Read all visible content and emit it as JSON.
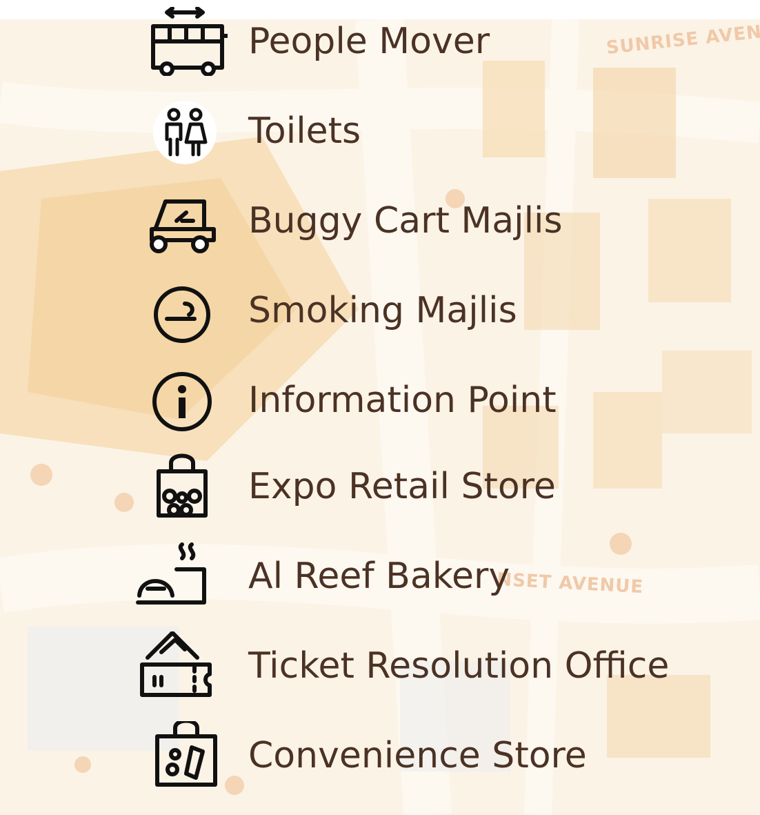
{
  "map": {
    "streets": [
      {
        "label": "SUNRISE AVENU"
      },
      {
        "label": "NSET AVENUE"
      }
    ]
  },
  "legend": {
    "items": [
      {
        "label": "People Mover",
        "icon": "people-mover-icon"
      },
      {
        "label": "Toilets",
        "icon": "toilets-icon"
      },
      {
        "label": "Buggy Cart Majlis",
        "icon": "buggy-cart-icon"
      },
      {
        "label": "Smoking Majlis",
        "icon": "smoking-icon"
      },
      {
        "label": "Information Point",
        "icon": "information-icon"
      },
      {
        "label": "Expo Retail Store",
        "icon": "shopping-bag-icon"
      },
      {
        "label": "Al Reef Bakery",
        "icon": "bakery-icon"
      },
      {
        "label": "Ticket Resolution Office",
        "icon": "ticket-icon"
      },
      {
        "label": "Convenience Store",
        "icon": "convenience-bag-icon"
      }
    ]
  },
  "colors": {
    "label_text": "#4a3225",
    "icon_stroke": "#111111",
    "map_base": "#fbf3e6",
    "map_building": "#f6dcb4",
    "map_road": "#fdf8f0"
  }
}
